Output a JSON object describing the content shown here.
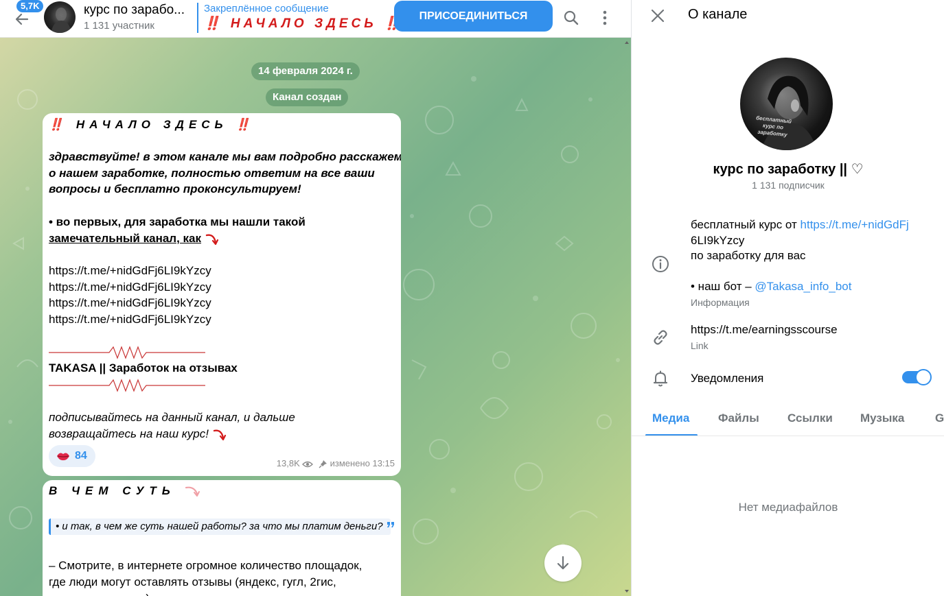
{
  "header": {
    "unread_count": "5,7K",
    "chat_title": "курс по зарабо...",
    "chat_subtitle": "1 131 участник",
    "pinned_label": "Закреплённое сообщение",
    "pinned_text": "‼️ НАЧАЛО ЗДЕСЬ ‼️",
    "join_button": "ПРИСОЕДИНИТЬСЯ",
    "icons": [
      "back-arrow-icon",
      "search-icon",
      "more-vertical-icon"
    ]
  },
  "chat": {
    "date_pill": "14 февраля 2024 г.",
    "service_message": "Канал создан",
    "message1": {
      "heading": "‼️ НАЧАЛО ЗДЕСЬ ‼️",
      "intro_lines": [
        "здравствуйте! в этом канале мы вам подробно расскажем",
        "о нашем заработке, полностью ответим на все ваши",
        "вопросы и бесплатно проконсультируем!"
      ],
      "point_line1": "• во первых, для заработка мы нашли такой",
      "point_line2": "замечательный канал, как",
      "links": [
        "https://t.me/+nidGdFj6LI9kYzcy",
        "https://t.me/+nidGdFj6LI9kYzcy",
        "https://t.me/+nidGdFj6LI9kYzcy",
        "https://t.me/+nidGdFj6LI9kYzcy"
      ],
      "channel_name": "TAKASA || Заработок на отзывах",
      "outro_lines": [
        "подписывайтесь на данный канал, и дальше",
        "возвращайтесь на наш курс!"
      ],
      "reaction_count": "84",
      "views": "13,8K",
      "edited_time": "изменено 13:15"
    },
    "message2": {
      "heading": "В ЧЕМ СУТЬ",
      "quote": "• и так, в чем же суть нашей работы? за что мы платим деньги?",
      "body_lines": [
        "– Смотрите, в интернете огромное количество площадок,",
        "где люди могут оставлять отзывы (яндекс, гугл, 2гис,",
        "авито и так далее)"
      ]
    }
  },
  "panel": {
    "title": "О канале",
    "avatar_caption": "бесплатный курс по заработку",
    "channel_name": "курс по заработку || ♡",
    "subscribers": "1 131 подписчик",
    "description_prefix": "бесплатный курс от ",
    "description_link_1": "https://t.me/+nidGdFj",
    "description_link_2": "6LI9kYzcy",
    "description_line3": "по заработку для вас",
    "bot_prefix": "• наш бот – ",
    "bot_link": "@Takasa_info_bot",
    "info_label": "Информация",
    "channel_link": "https://t.me/earningsscourse",
    "link_label": "Link",
    "notifications_label": "Уведомления",
    "notifications_on": true,
    "tabs": [
      "Медиа",
      "Файлы",
      "Ссылки",
      "Музыка",
      "G"
    ],
    "active_tab": "Медиа",
    "empty_media": "Нет медиафайлов"
  },
  "colors": {
    "accent": "#3390ec",
    "heading_red": "#d31b1b",
    "heading_pink": "#f0a0a6"
  }
}
